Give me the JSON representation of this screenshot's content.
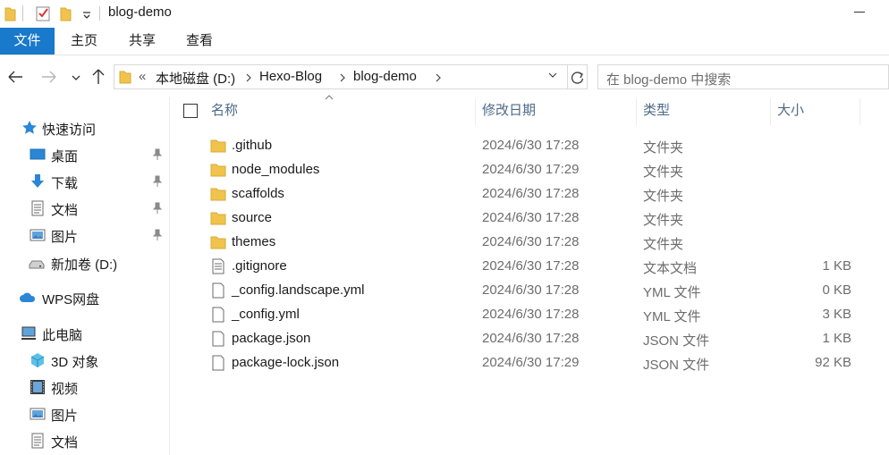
{
  "window": {
    "title": "blog-demo"
  },
  "ribbon": {
    "tabs": [
      "文件",
      "主页",
      "共享",
      "查看"
    ]
  },
  "address": {
    "overflow": "«",
    "crumbs": [
      "本地磁盘 (D:)",
      "Hexo-Blog",
      "blog-demo"
    ]
  },
  "search": {
    "placeholder": "在 blog-demo 中搜索"
  },
  "sidebar": {
    "items": [
      {
        "label": "快速访问",
        "icon": "star-icon"
      },
      {
        "label": "桌面",
        "icon": "desktop-icon",
        "pinned": true
      },
      {
        "label": "下载",
        "icon": "download-icon",
        "pinned": true
      },
      {
        "label": "文档",
        "icon": "document-icon",
        "pinned": true
      },
      {
        "label": "图片",
        "icon": "picture-icon",
        "pinned": true
      },
      {
        "label": "新加卷 (D:)",
        "icon": "drive-icon"
      },
      {
        "label": "WPS网盘",
        "icon": "cloud-icon"
      },
      {
        "label": "此电脑",
        "icon": "computer-icon"
      },
      {
        "label": "3D 对象",
        "icon": "cube-icon"
      },
      {
        "label": "视频",
        "icon": "video-icon"
      },
      {
        "label": "图片",
        "icon": "picture-icon"
      },
      {
        "label": "文档",
        "icon": "document-icon"
      }
    ]
  },
  "columns": {
    "name": "名称",
    "date": "修改日期",
    "type": "类型",
    "size": "大小"
  },
  "files": [
    {
      "name": ".github",
      "date": "2024/6/30 17:28",
      "type": "文件夹",
      "size": "",
      "kind": "folder"
    },
    {
      "name": "node_modules",
      "date": "2024/6/30 17:29",
      "type": "文件夹",
      "size": "",
      "kind": "folder"
    },
    {
      "name": "scaffolds",
      "date": "2024/6/30 17:28",
      "type": "文件夹",
      "size": "",
      "kind": "folder"
    },
    {
      "name": "source",
      "date": "2024/6/30 17:28",
      "type": "文件夹",
      "size": "",
      "kind": "folder"
    },
    {
      "name": "themes",
      "date": "2024/6/30 17:28",
      "type": "文件夹",
      "size": "",
      "kind": "folder"
    },
    {
      "name": ".gitignore",
      "date": "2024/6/30 17:28",
      "type": "文本文档",
      "size": "1 KB",
      "kind": "text"
    },
    {
      "name": "_config.landscape.yml",
      "date": "2024/6/30 17:28",
      "type": "YML 文件",
      "size": "0 KB",
      "kind": "file"
    },
    {
      "name": "_config.yml",
      "date": "2024/6/30 17:28",
      "type": "YML 文件",
      "size": "3 KB",
      "kind": "file"
    },
    {
      "name": "package.json",
      "date": "2024/6/30 17:28",
      "type": "JSON 文件",
      "size": "1 KB",
      "kind": "file"
    },
    {
      "name": "package-lock.json",
      "date": "2024/6/30 17:29",
      "type": "JSON 文件",
      "size": "92 KB",
      "kind": "file"
    }
  ],
  "colors": {
    "accent": "#1979ca",
    "folder": "#f0c44c",
    "header_text": "#4d6a86"
  }
}
